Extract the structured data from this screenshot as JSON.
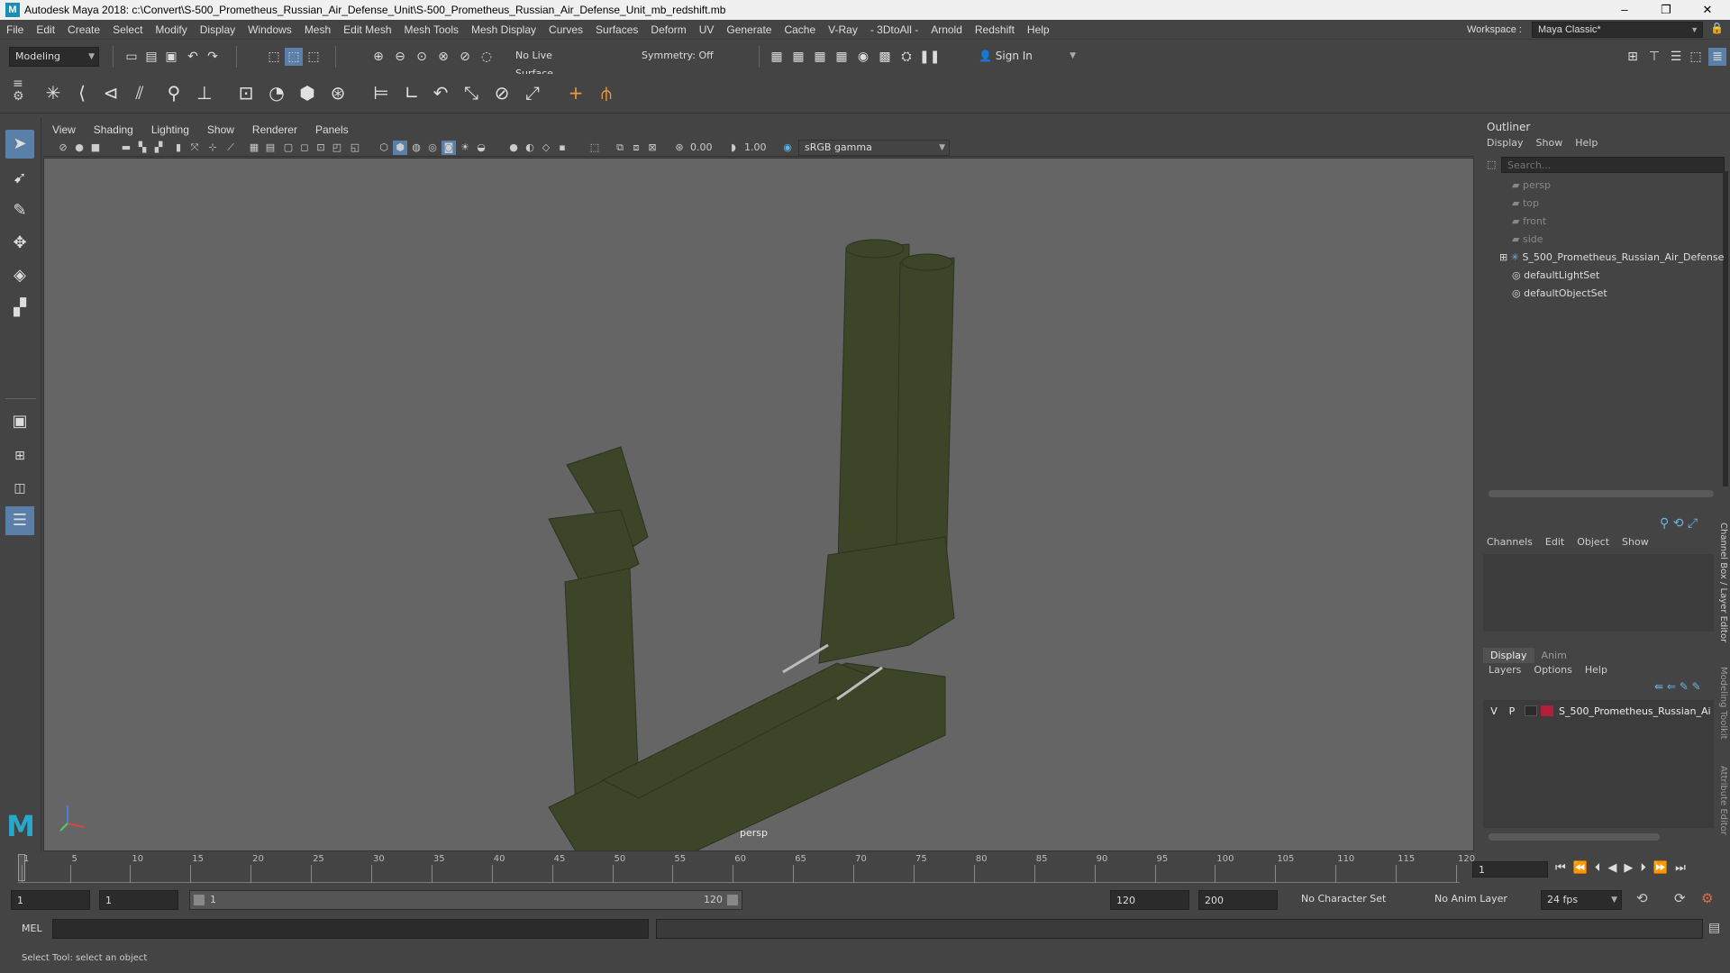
{
  "window": {
    "title": "Autodesk Maya 2018: c:\\Convert\\S-500_Prometheus_Russian_Air_Defense_Unit\\S-500_Prometheus_Russian_Air_Defense_Unit_mb_redshift.mb",
    "logo": "M",
    "minimize": "–",
    "maximize": "❐",
    "close": "✕"
  },
  "menubar": {
    "items": [
      "File",
      "Edit",
      "Create",
      "Select",
      "Modify",
      "Display",
      "Windows",
      "Mesh",
      "Edit Mesh",
      "Mesh Tools",
      "Mesh Display",
      "Curves",
      "Surfaces",
      "Deform",
      "UV",
      "Generate",
      "Cache",
      "V-Ray",
      "- 3DtoAll -",
      "Arnold",
      "Redshift",
      "Help"
    ],
    "workspace_label": "Workspace :",
    "workspace_value": "Maya Classic*"
  },
  "statusline": {
    "mode": "Modeling",
    "live_surface": "No Live Surface",
    "symmetry": "Symmetry: Off",
    "sign_in": "Sign In"
  },
  "viewport": {
    "menus": [
      "View",
      "Shading",
      "Lighting",
      "Show",
      "Renderer",
      "Panels"
    ],
    "exposure": "0.00",
    "gamma": "1.00",
    "color_space": "sRGB gamma",
    "camera_label": "persp",
    "model_color": "#3c4528"
  },
  "outliner": {
    "title": "Outliner",
    "menus": [
      "Display",
      "Show",
      "Help"
    ],
    "search_placeholder": "Search...",
    "items": [
      {
        "label": "persp",
        "icon": "camera-icon",
        "dim": true
      },
      {
        "label": "top",
        "icon": "camera-icon",
        "dim": true
      },
      {
        "label": "front",
        "icon": "camera-icon",
        "dim": true
      },
      {
        "label": "side",
        "icon": "camera-icon",
        "dim": true
      },
      {
        "label": "S_500_Prometheus_Russian_Air_Defense",
        "icon": "group-icon",
        "dim": false
      },
      {
        "label": "defaultLightSet",
        "icon": "set-icon",
        "dim": false
      },
      {
        "label": "defaultObjectSet",
        "icon": "set-icon",
        "dim": false
      }
    ]
  },
  "channelbox": {
    "menus": [
      "Channels",
      "Edit",
      "Object",
      "Show"
    ],
    "side_tabs": [
      "Channel Box / Layer Editor",
      "Modeling Toolkit",
      "Attribute Editor"
    ]
  },
  "layers": {
    "tabs": [
      "Display",
      "Anim"
    ],
    "menus": [
      "Layers",
      "Options",
      "Help"
    ],
    "row": {
      "v": "V",
      "p": "P",
      "name": "S_500_Prometheus_Russian_Ai",
      "color": "#b0203a"
    }
  },
  "timeline": {
    "ticks": [
      "1",
      "5",
      "10",
      "15",
      "20",
      "25",
      "30",
      "35",
      "40",
      "45",
      "50",
      "55",
      "60",
      "65",
      "70",
      "75",
      "80",
      "85",
      "90",
      "95",
      "100",
      "105",
      "110",
      "115",
      "120"
    ],
    "current_frame": "1"
  },
  "range": {
    "start": "1",
    "playback_start": "1",
    "slider_start": "1",
    "slider_end": "120",
    "playback_end": "120",
    "end": "200",
    "character_set": "No Character Set",
    "anim_layer": "No Anim Layer",
    "fps": "24 fps"
  },
  "command": {
    "label": "MEL"
  },
  "helpline": {
    "text": "Select Tool: select an object"
  }
}
